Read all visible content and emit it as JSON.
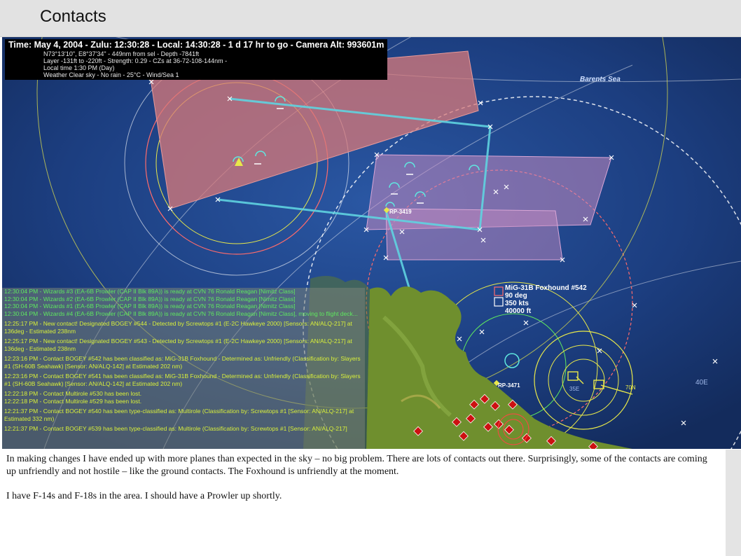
{
  "page": {
    "title": "Contacts"
  },
  "hud": {
    "title": "Time: May 4, 2004 - Zulu: 12:30:28 - Local: 14:30:28 - 1 d 17 hr to go -  Camera Alt: 993601m",
    "lines": [
      "N73°13'10\", E8°37'34\" - 449nm from sel - Depth -7841ft",
      "Layer -131ft to -220ft - Strength: 0.29 - CZs at 36-72-108-144nm -",
      "Local time 1:30 PM (Day)",
      "Weather Clear sky - No rain - 25°C - Wind/Sea 1"
    ]
  },
  "map": {
    "region_label": "Barents Sea",
    "waypoint_labels": [
      "RP-3419",
      "RP-3471"
    ],
    "contact": {
      "name": "MiG-31B Foxhound #542",
      "heading": "90 deg",
      "speed": "350 kts",
      "altitude": "40000 ft"
    },
    "grid_labels": [
      "70N",
      "40E",
      "35E"
    ],
    "colors": {
      "sea": "#1d3d7a",
      "hostile_zone": "#d97a7a",
      "patrol_zone": "#c48ac0",
      "route": "#5fd3e0",
      "range_ring_red": "#ff6b6b",
      "range_ring_yellow": "#e8e84a",
      "land": "#6f8f2e",
      "hostile_unit": "#cc1111"
    }
  },
  "log": {
    "entries": [
      {
        "text": "12:30:04 PM - Wizards #3 (EA-6B Prowler (CAP II Blk 89A)) is ready at CVN 76 Ronald Reagan [Nimitz Class]",
        "style": "green"
      },
      {
        "text": "12:30:04 PM - Wizards #2 (EA-6B Prowler (CAP II Blk 89A)) is ready at CVN 76 Ronald Reagan [Nimitz Class]",
        "style": "green"
      },
      {
        "text": "12:30:04 PM - Wizards #1 (EA-6B Prowler (CAP II Blk 89A)) is ready at CVN 76 Ronald Reagan [Nimitz Class]",
        "style": "green"
      },
      {
        "text": "12:30:04 PM - Wizards #4 (EA-6B Prowler (CAP II Blk 89A)) is ready at CVN 76 Ronald Reagan [Nimitz Class], moving to flight deck...",
        "style": "green"
      },
      {
        "text": "12:25:17 PM - New contact! Designated BOGEY #544 - Detected by Screwtops #1 (E-2C Hawkeye 2000)  [Sensors: AN/ALQ-217] at 136deg - Estimated 238nm",
        "style": "yellow"
      },
      {
        "text": "12:25:17 PM - New contact! Designated BOGEY #543 - Detected by Screwtops #1 (E-2C Hawkeye 2000)  [Sensors: AN/ALQ-217] at 136deg - Estimated 238nm",
        "style": "yellow"
      },
      {
        "text": "12:23:16 PM - Contact BOGEY #542 has been classified as: MiG-31B Foxhound - Determined as: Unfriendly (Classification by: Slayers #1 (SH-60B Seahawk) [Sensor: AN/ALQ-142] at Estimated 202 nm)",
        "style": "yellow"
      },
      {
        "text": "12:23:16 PM - Contact BOGEY #541 has been classified as: MiG-31B Foxhound - Determined as: Unfriendly (Classification by: Slayers #1 (SH-60B Seahawk) [Sensor: AN/ALQ-142] at Estimated 202 nm)",
        "style": "yellow"
      },
      {
        "text": "12:22:18 PM - Contact Multirole #530 has been lost.",
        "style": "yellow"
      },
      {
        "text": "12:22:18 PM - Contact Multirole #529 has been lost.",
        "style": "yellow"
      },
      {
        "text": "12:21:37 PM - Contact BOGEY #540 has been type-classified as: Multirole (Classification by: Screwtops #1 [Sensor: AN/ALQ-217] at Estimated 332 nm)",
        "style": "yellow"
      },
      {
        "text": "12:21:37 PM - Contact BOGEY #539 has been type-classified as: Multirole (Classification by: Screwtops #1 [Sensor: AN/ALQ-217]",
        "style": "yellow"
      }
    ]
  },
  "body": {
    "paragraphs": [
      "In making changes I have ended up with more planes than expected in the sky – no big problem.  There are lots of contacts out there.  Surprisingly, some of the contacts are coming up unfriendly and not hostile – like the ground contacts.  The Foxhound is unfriendly at the moment.",
      "I have F-14s and F-18s in the area.  I should have a Prowler up shortly."
    ]
  }
}
